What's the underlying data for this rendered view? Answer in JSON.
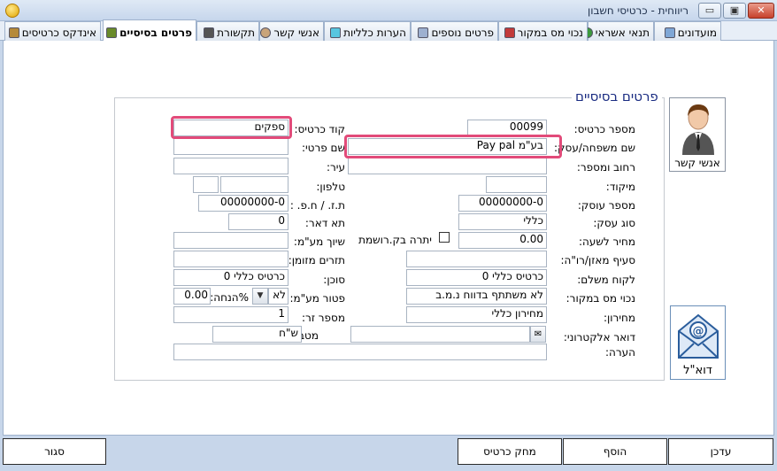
{
  "window": {
    "title": "ריווחית - כרטיסי חשבון",
    "minimize": "▭",
    "restore": "▣",
    "close": "✕"
  },
  "tabs": [
    {
      "label": "מועדונים"
    },
    {
      "label": "תנאי אשראי"
    },
    {
      "label": "נכוי מס במקור"
    },
    {
      "label": "פרטים נוספים"
    },
    {
      "label": "הערות כלליות"
    },
    {
      "label": "אנשי קשר"
    },
    {
      "label": "תקשורת"
    },
    {
      "label": "פרטים בסיסיים"
    },
    {
      "label": "אינדקס כרטיסים"
    }
  ],
  "form": {
    "section_title": "פרטים בסיסיים",
    "card_number_label": "מספר כרטיס:",
    "card_number": "00099",
    "card_code_label": "קוד כרטיס:",
    "card_code": "ספקים",
    "family_name_label": "שם משפחה/עסק:",
    "family_name": "Pay pal בע\"מ",
    "first_name_label": "שם פרטי:",
    "first_name": "",
    "street_label": "רחוב ומספר:",
    "street": "",
    "city_label": "עיר:",
    "city": "",
    "zip_label": "מיקוד:",
    "zip": "",
    "phone_label": "טלפון:",
    "phone": "",
    "phone_prefix": "",
    "business_number_label": "מספר עוסק:",
    "business_number": "00000000-0",
    "id_label": "ת.ז. / ח.פ. :",
    "id_value": "00000000-0",
    "business_type_label": "סוג עסק:",
    "business_type": "כללי",
    "po_box_label": "תא דאר:",
    "po_box": "0",
    "hourly_price_label": "מחיר לשעה:",
    "hourly_price": "0.00",
    "registered_balance_label": "יתרה בק.רושמת",
    "vat_assignment_label": "שיוך מע\"מ:",
    "vat_assignment": "",
    "balance_clause_label": "סעיף מאזן/רו\"ה:",
    "balance_clause": "",
    "cash_flow_label": "תזרים מזומן:",
    "cash_flow": "",
    "paying_customer_label": "לקוח משלם:",
    "paying_customer": "כרטיס כללי 0",
    "agent_label": "סוכן:",
    "agent": "כרטיס כללי 0",
    "withholding_label": "נכוי מס במקור:",
    "withholding": "לא משתתף בדווח נ.מ.ב",
    "vat_exempt_label": "פטור מע\"מ:",
    "vat_exempt": "לא",
    "discount_label": "%הנחה:",
    "discount": "0.00",
    "price_list_label": "מחירון:",
    "price_list": "מחירון כללי",
    "foreign_number_label": "מספר זר:",
    "foreign_number": "1",
    "email_label": "דואר אלקטרוני:",
    "email": "",
    "currency_label": "מטבע:",
    "currency": "ש\"ח",
    "note_label": "הערה:",
    "note": ""
  },
  "side": {
    "contacts_caption": "אנשי קשר",
    "email_caption": "דוא\"ל"
  },
  "footer": {
    "update": "עדכן",
    "add": "הוסף",
    "delete_card": "מחק כרטיס",
    "close": "סגור"
  },
  "colors": {
    "highlight": "#e24b7a",
    "section_title": "#1a2c82"
  }
}
